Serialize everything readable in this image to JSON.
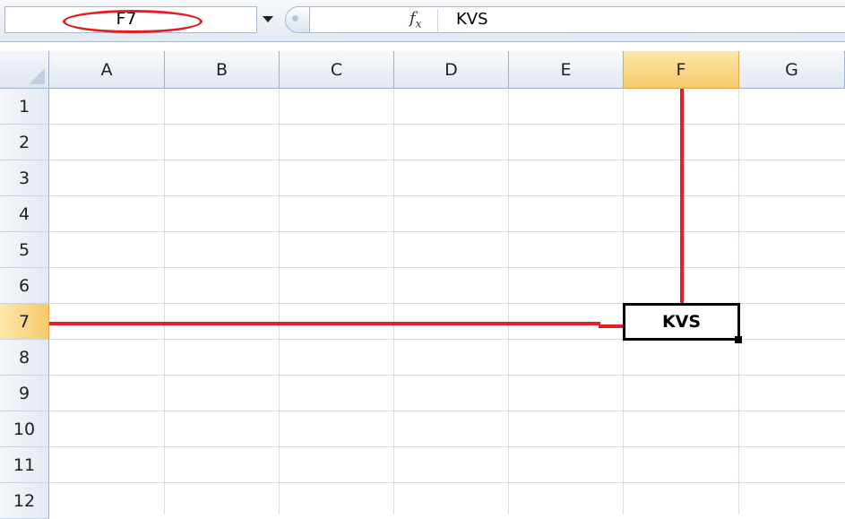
{
  "formula_bar": {
    "name_box_value": "F7",
    "fx_label": "fx",
    "formula_value": "KVS"
  },
  "sheet": {
    "columns": [
      "A",
      "B",
      "C",
      "D",
      "E",
      "F",
      "G"
    ],
    "rows": [
      "1",
      "2",
      "3",
      "4",
      "5",
      "6",
      "7",
      "8",
      "9",
      "10",
      "11",
      "12"
    ],
    "selected_column": "F",
    "selected_row": "7",
    "active_cell_value": "KVS"
  },
  "colors": {
    "annotation_red": "#e3202a",
    "header_selected": "#f7c96b",
    "gridline": "#d4dce6"
  },
  "icons": {
    "name_box_dropdown": "chevron-down-icon",
    "function_button": "fx-icon",
    "select_all": "select-all-corner-icon"
  }
}
